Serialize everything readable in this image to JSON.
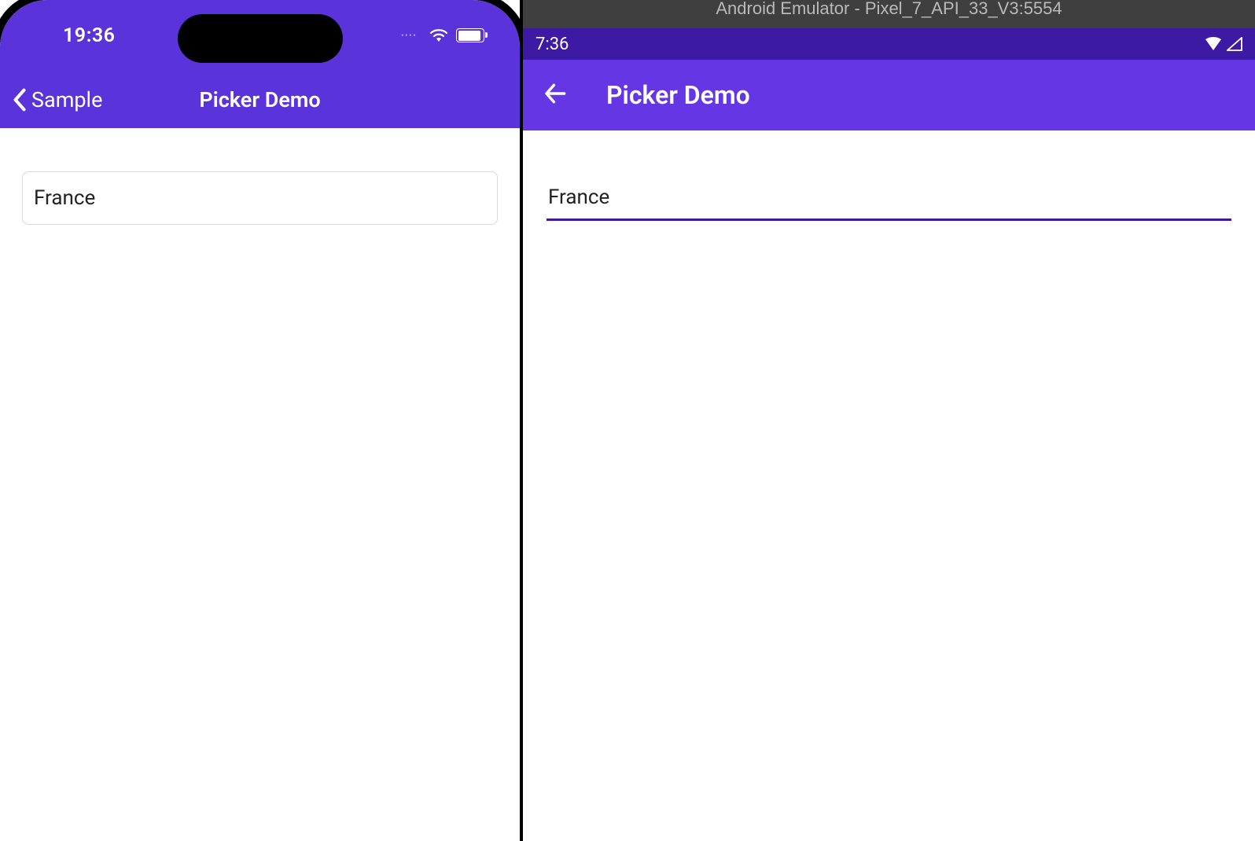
{
  "ios": {
    "status": {
      "time": "19:36"
    },
    "nav": {
      "back_label": "Sample",
      "title": "Picker Demo"
    },
    "picker": {
      "selected_value": "France"
    }
  },
  "android": {
    "emulator_title": "Android Emulator - Pixel_7_API_33_V3:5554",
    "status": {
      "time": "7:36"
    },
    "appbar": {
      "title": "Picker Demo"
    },
    "picker": {
      "selected_value": "France"
    }
  },
  "colors": {
    "ios_primary": "#5b33da",
    "android_primary": "#6537e4",
    "android_primary_dark": "#3c1aa3"
  }
}
